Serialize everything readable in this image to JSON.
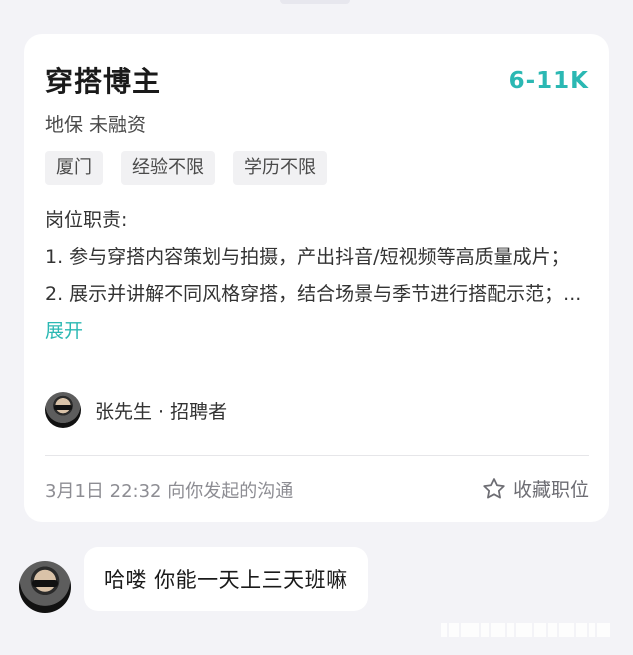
{
  "job": {
    "title": "穿搭博主",
    "salary": "6-11K",
    "company": "地保 未融资",
    "tags": [
      "厦门",
      "经验不限",
      "学历不限"
    ],
    "description_heading": "岗位职责:",
    "description_lines": [
      "1. 参与穿搭内容策划与拍摄，产出抖音/短视频等高质量成片；",
      "2. 展示并讲解不同风格穿搭，结合场景与季节进行搭配示范；..."
    ],
    "expand_label": "展开",
    "recruiter_name": "张先生 · 招聘者",
    "timestamp": "3月1日 22:32 向你发起的沟通",
    "collect_label": "收藏职位"
  },
  "chat": {
    "message": "哈喽 你能一天上三天班嘛"
  },
  "colors": {
    "accent": "#2bb8b3",
    "background": "#f3f3f7"
  },
  "icons": {
    "collect": "star-outline-icon"
  }
}
